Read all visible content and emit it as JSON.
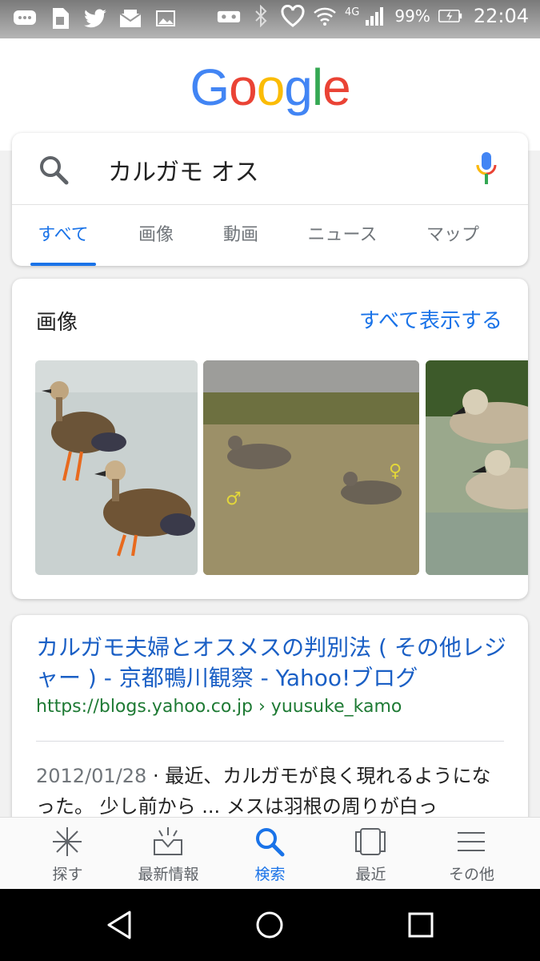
{
  "status_bar": {
    "battery": "99%",
    "time": "22:04",
    "network": "4G",
    "icons_left": [
      "message-icon",
      "sim-icon",
      "twitter-icon",
      "mail-icon",
      "image-icon"
    ],
    "icons_right": [
      "vr-icon",
      "bluetooth-icon",
      "heart-icon",
      "wifi-icon",
      "signal-icon",
      "battery-icon"
    ]
  },
  "logo": {
    "letters": [
      "G",
      "o",
      "o",
      "g",
      "l",
      "e"
    ],
    "colors": [
      "#4285F4",
      "#EA4335",
      "#FBBC05",
      "#4285F4",
      "#34A853",
      "#EA4335"
    ]
  },
  "search": {
    "query": "カルガモ オス",
    "tabs": [
      "すべて",
      "画像",
      "動画",
      "ニュース",
      "マップ"
    ],
    "active_tab": "すべて"
  },
  "images": {
    "title": "画像",
    "more_link": "すべて表示する"
  },
  "result": {
    "title": "カルガモ夫婦とオスメスの判別法 ( その他レジャー ) - 京都鴨川観察 - Yahoo!ブログ",
    "url": "https://blogs.yahoo.co.jp › yuusuke_kamo",
    "date": "2012/01/28",
    "snippet": " · 最近、カルガモが良く現れるようになった。 少し前から ... メスは羽根の周りが白っ"
  },
  "bottom_nav": {
    "items": [
      {
        "label": "探す",
        "icon": "explore-icon"
      },
      {
        "label": "最新情報",
        "icon": "updates-icon"
      },
      {
        "label": "検索",
        "icon": "search-icon"
      },
      {
        "label": "最近",
        "icon": "recent-icon"
      },
      {
        "label": "その他",
        "icon": "menu-icon"
      }
    ],
    "active": "検索"
  },
  "colors": {
    "accent": "#1a73e8",
    "link": "#1a5fc5",
    "url": "#1e7a34"
  }
}
